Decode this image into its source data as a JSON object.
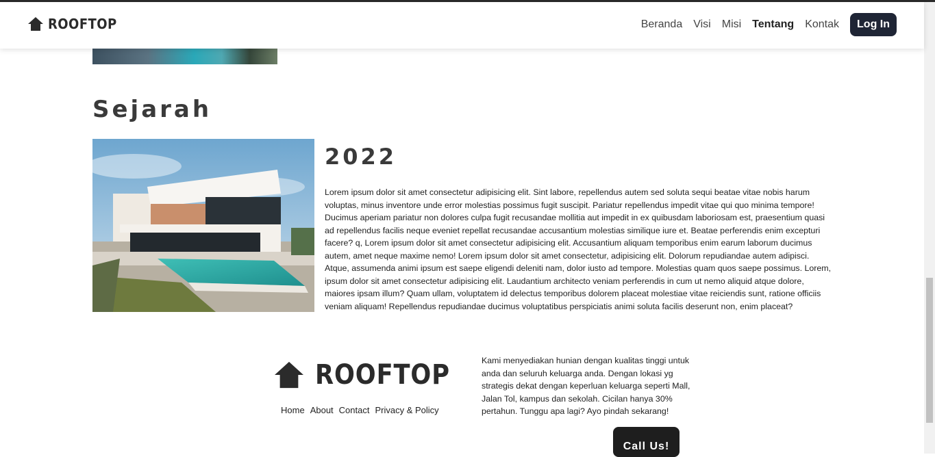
{
  "header": {
    "brand": "ROOFTOP",
    "nav": [
      "Beranda",
      "Visi",
      "Misi",
      "Tentang",
      "Kontak"
    ],
    "active": "Tentang",
    "login_label": "Log In"
  },
  "history": {
    "title": "Sejarah",
    "year": "2022",
    "text": "Lorem ipsum dolor sit amet consectetur adipisicing elit. Sint labore, repellendus autem sed soluta sequi beatae vitae nobis harum voluptas, minus inventore unde error molestias possimus fugit suscipit. Pariatur repellendus impedit vitae qui quo minima tempore! Ducimus aperiam pariatur non dolores culpa fugit recusandae mollitia aut impedit in ex quibusdam laboriosam est, praesentium quasi ad repellendus facilis neque eveniet repellat recusandae accusantium molestias similique iure et. Beatae perferendis enim excepturi facere? q, Lorem ipsum dolor sit amet consectetur adipisicing elit. Accusantium aliquam temporibus enim earum laborum ducimus autem, amet neque maxime nemo! Lorem ipsum dolor sit amet consectetur, adipisicing elit. Dolorum repudiandae autem adipisci. Atque, assumenda animi ipsum est saepe eligendi deleniti nam, dolor iusto ad tempore. Molestias quam quos saepe possimus. Lorem, ipsum dolor sit amet consectetur adipisicing elit. Laudantium architecto veniam perferendis in cum ut nemo aliquid atque dolore, maiores ipsam illum? Quam ullam, voluptatem id delectus temporibus dolorem placeat molestiae vitae reiciendis sunt, ratione officiis veniam aliquam! Repellendus repudiandae ducimus voluptatibus perspiciatis animi soluta facilis deserunt non, enim placeat?"
  },
  "footer": {
    "brand": "ROOFTOP",
    "links": [
      "Home",
      "About",
      "Contact",
      "Privacy & Policy"
    ],
    "description": "Kami menyediakan hunian dengan kualitas tinggi untuk anda dan seluruh keluarga anda. Dengan lokasi yg strategis dekat dengan keperluan keluarga seperti Mall, Jalan Tol, kampus dan sekolah. Cicilan hanya 30% pertahun. Tunggu apa lagi? Ayo pindah sekarang!",
    "call_label": "Call Us!"
  },
  "colors": {
    "navbar_button": "#1f2535",
    "call_button": "#1e1e1e",
    "heading": "#3a3a3a"
  },
  "icons": [
    "house-icon"
  ]
}
